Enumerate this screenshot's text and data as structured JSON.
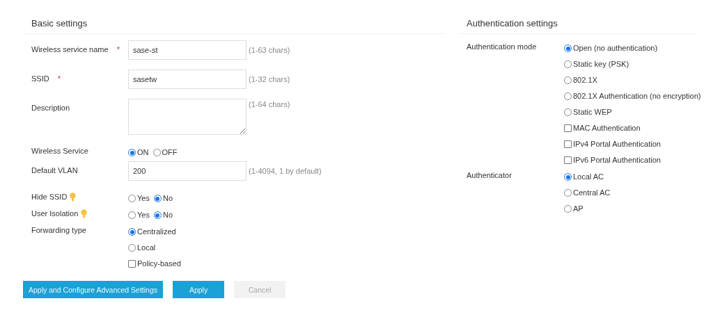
{
  "basic_settings": {
    "title": "Basic settings",
    "fields": [
      {
        "kind": "text",
        "label": "Wireless service name",
        "required_mark": "*",
        "value": "sase-st",
        "hint": "(1-63 chars)"
      },
      {
        "kind": "text",
        "label": "SSID",
        "required_mark": "*",
        "value": "sasetw",
        "hint": "(1-32 chars)"
      },
      {
        "kind": "textarea",
        "label": "Description",
        "hint": "(1-64 chars)"
      },
      {
        "kind": "inline_choice",
        "label": "Wireless Service",
        "options": [
          {
            "kind": "radio",
            "label": "ON",
            "selected": true
          },
          {
            "kind": "radio",
            "label": "OFF",
            "selected": false
          }
        ]
      },
      {
        "kind": "text",
        "label": "Default VLAN",
        "value": "200",
        "hint": "(1-4094, 1 by default)"
      },
      {
        "kind": "inline_choice",
        "label": "Hide SSID",
        "help_icon": true,
        "options": [
          {
            "kind": "radio",
            "label": "Yes",
            "selected": false
          },
          {
            "kind": "radio",
            "label": "No",
            "selected": true
          }
        ]
      },
      {
        "kind": "inline_choice",
        "label": "User Isolation",
        "help_icon": true,
        "options": [
          {
            "kind": "radio",
            "label": "Yes",
            "selected": false
          },
          {
            "kind": "radio",
            "label": "No",
            "selected": true
          }
        ]
      },
      {
        "kind": "stacked_choice",
        "label": "Forwarding type",
        "options": [
          {
            "kind": "radio",
            "label": "Centralized",
            "selected": true
          },
          {
            "kind": "radio",
            "label": "Local",
            "selected": false
          },
          {
            "kind": "checkbox",
            "label": "Policy-based",
            "checked": false
          }
        ]
      }
    ]
  },
  "authentication_settings": {
    "title": "Authentication settings",
    "fields": [
      {
        "kind": "stacked_choice",
        "label": "Authentication mode",
        "options": [
          {
            "kind": "radio",
            "label": "Open (no authentication)",
            "selected": true
          },
          {
            "kind": "radio",
            "label": "Static key (PSK)",
            "selected": false
          },
          {
            "kind": "radio",
            "label": "802.1X",
            "selected": false
          },
          {
            "kind": "radio",
            "label": "802.1X Authentication (no encryption)",
            "selected": false
          },
          {
            "kind": "radio",
            "label": "Static WEP",
            "selected": false
          },
          {
            "kind": "checkbox",
            "label": "MAC Authentication",
            "checked": false
          },
          {
            "kind": "checkbox",
            "label": "IPv4 Portal Authentication",
            "checked": false
          },
          {
            "kind": "checkbox",
            "label": "IPv6 Portal Authentication",
            "checked": false
          }
        ]
      },
      {
        "kind": "stacked_choice",
        "label": "Authenticator",
        "options": [
          {
            "kind": "radio",
            "label": "Local AC",
            "selected": true
          },
          {
            "kind": "radio",
            "label": "Central AC",
            "selected": false
          },
          {
            "kind": "radio",
            "label": "AP",
            "selected": false
          }
        ]
      }
    ]
  },
  "buttons": [
    {
      "kind": "primary",
      "label": "Apply and Configure Advanced Settings"
    },
    {
      "kind": "primary",
      "label": "Apply"
    },
    {
      "kind": "disabled",
      "label": "Cancel"
    }
  ]
}
